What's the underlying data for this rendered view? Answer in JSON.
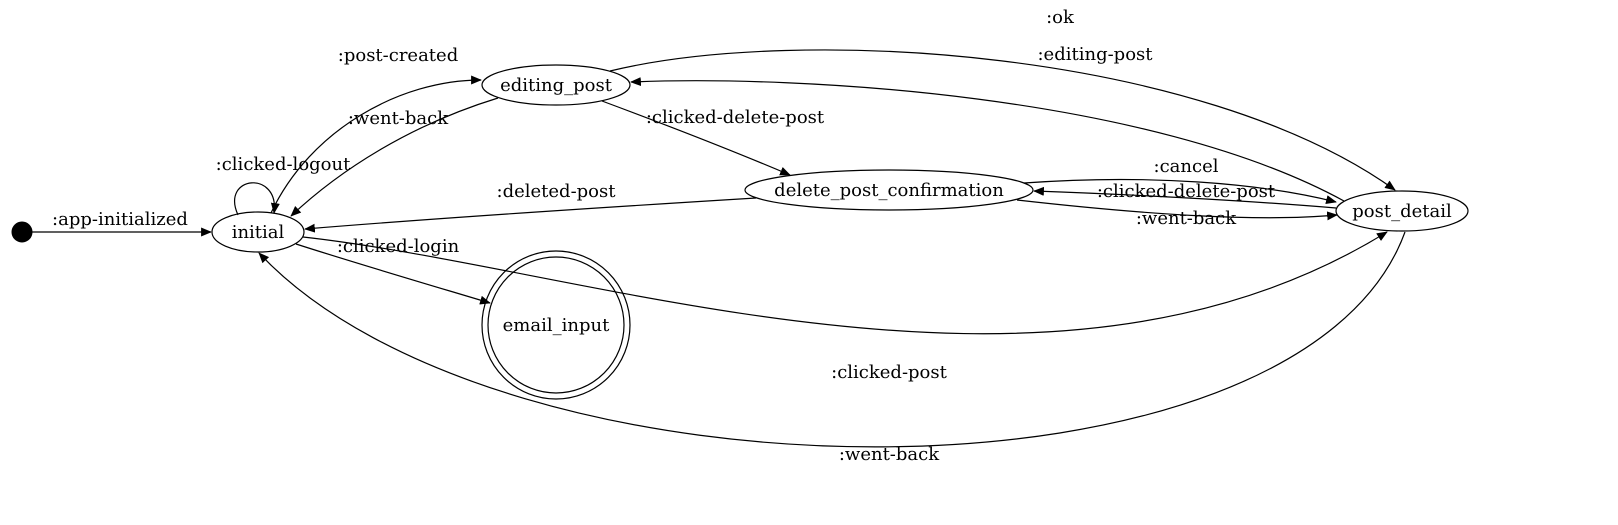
{
  "diagram": {
    "type": "state-machine",
    "states": {
      "start": {
        "label": ""
      },
      "initial": {
        "label": "initial"
      },
      "editing_post": {
        "label": "editing_post"
      },
      "email_input": {
        "label": "email_input",
        "accepting": true
      },
      "delete_post_confirmation": {
        "label": "delete_post_confirmation"
      },
      "post_detail": {
        "label": "post_detail"
      }
    },
    "transitions": {
      "app_initialized": {
        "from": "start",
        "to": "initial",
        "label": ":app-initialized"
      },
      "clicked_logout": {
        "from": "initial",
        "to": "initial",
        "label": ":clicked-logout"
      },
      "post_created": {
        "from": "initial",
        "to": "editing_post",
        "label": ":post-created"
      },
      "went_back_ep": {
        "from": "editing_post",
        "to": "initial",
        "label": ":went-back"
      },
      "clicked_login": {
        "from": "initial",
        "to": "email_input",
        "label": ":clicked-login"
      },
      "ok": {
        "from": "editing_post",
        "to": "post_detail",
        "label": ":ok"
      },
      "editing_post_t": {
        "from": "post_detail",
        "to": "editing_post",
        "label": ":editing-post"
      },
      "clicked_del_ep": {
        "from": "editing_post",
        "to": "delete_post_confirmation",
        "label": ":clicked-delete-post"
      },
      "deleted_post": {
        "from": "delete_post_confirmation",
        "to": "initial",
        "label": ":deleted-post"
      },
      "cancel": {
        "from": "delete_post_confirmation",
        "to": "post_detail",
        "label": ":cancel"
      },
      "clicked_del_pd": {
        "from": "post_detail",
        "to": "delete_post_confirmation",
        "label": ":clicked-delete-post"
      },
      "went_back_dpc": {
        "from": "delete_post_confirmation",
        "to": "post_detail",
        "label": ":went-back"
      },
      "clicked_post": {
        "from": "initial",
        "to": "post_detail",
        "label": ":clicked-post"
      },
      "went_back_pd": {
        "from": "post_detail",
        "to": "initial",
        "label": ":went-back"
      }
    }
  }
}
